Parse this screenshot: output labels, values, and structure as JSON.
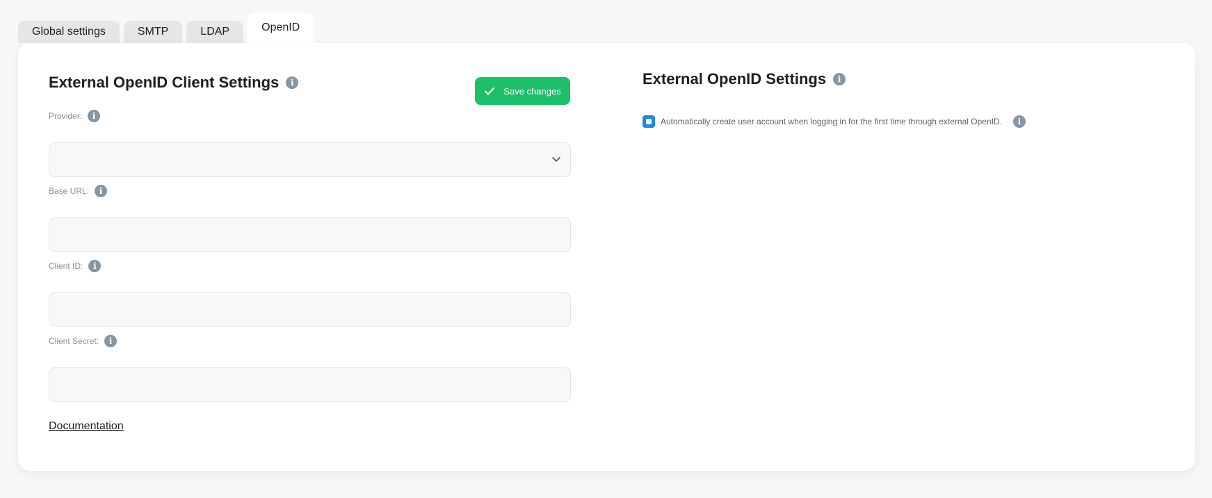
{
  "tabs": [
    {
      "label": "Global settings",
      "active": false
    },
    {
      "label": "SMTP",
      "active": false
    },
    {
      "label": "LDAP",
      "active": false
    },
    {
      "label": "OpenID",
      "active": true
    }
  ],
  "client_settings": {
    "title": "External OpenID Client Settings",
    "save_label": "Save changes",
    "fields": {
      "provider": {
        "label": "Provider:",
        "value": ""
      },
      "base_url": {
        "label": "Base URL:",
        "value": ""
      },
      "client_id": {
        "label": "Client ID:",
        "value": ""
      },
      "client_secret": {
        "label": "Client Secret:",
        "value": ""
      }
    },
    "documentation_link": "Documentation"
  },
  "openid_settings": {
    "title": "External OpenID Settings",
    "auto_create_label": "Automatically create user account when logging in for the first time through external OpenID.",
    "auto_create_checked": true
  },
  "colors": {
    "accent_green": "#1dbf6b",
    "checkbox_blue": "#1e88e5",
    "info_icon": "#8896a4"
  },
  "icons": {
    "info": "info-icon",
    "check": "check-icon",
    "chevron": "chevron-down-icon"
  }
}
